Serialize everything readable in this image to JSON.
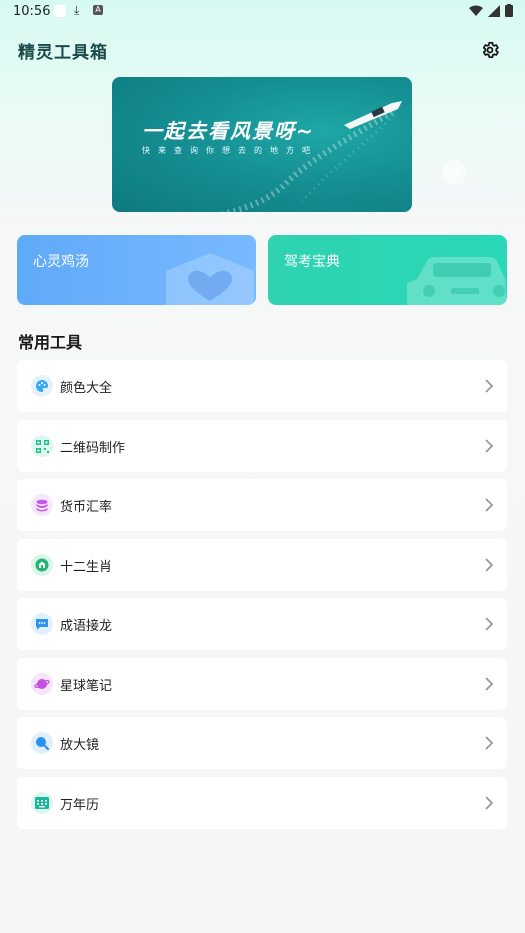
{
  "status_bar": {
    "time": "10:56"
  },
  "header": {
    "title": "精灵工具箱"
  },
  "banner": {
    "headline": "一起去看风景呀~",
    "subline": "快来查询你想去的地方吧"
  },
  "feature_cards": [
    {
      "label": "心灵鸡汤"
    },
    {
      "label": "驾考宝典"
    }
  ],
  "section": {
    "title": "常用工具"
  },
  "tools": [
    {
      "label": "颜色大全",
      "icon": "palette-icon",
      "color": "#3aa7f5",
      "bg": "#e3f2fd"
    },
    {
      "label": "二维码制作",
      "icon": "qrcode-icon",
      "color": "#1fbf8f",
      "bg": "#dff7ee"
    },
    {
      "label": "货币汇率",
      "icon": "coins-icon",
      "color": "#c757e6",
      "bg": "#f6e7fb"
    },
    {
      "label": "十二生肖",
      "icon": "zodiac-icon",
      "color": "#22b573",
      "bg": "#dcf5e9"
    },
    {
      "label": "成语接龙",
      "icon": "chat-icon",
      "color": "#2f95f0",
      "bg": "#e2f0fd"
    },
    {
      "label": "星球笔记",
      "icon": "planet-icon",
      "color": "#c54fe0",
      "bg": "#f5e5fa"
    },
    {
      "label": "放大镜",
      "icon": "magnifier-icon",
      "color": "#2d8ff0",
      "bg": "#e1eefc"
    },
    {
      "label": "万年历",
      "icon": "calendar-icon",
      "color": "#16b99a",
      "bg": "#dcf6f0"
    }
  ]
}
